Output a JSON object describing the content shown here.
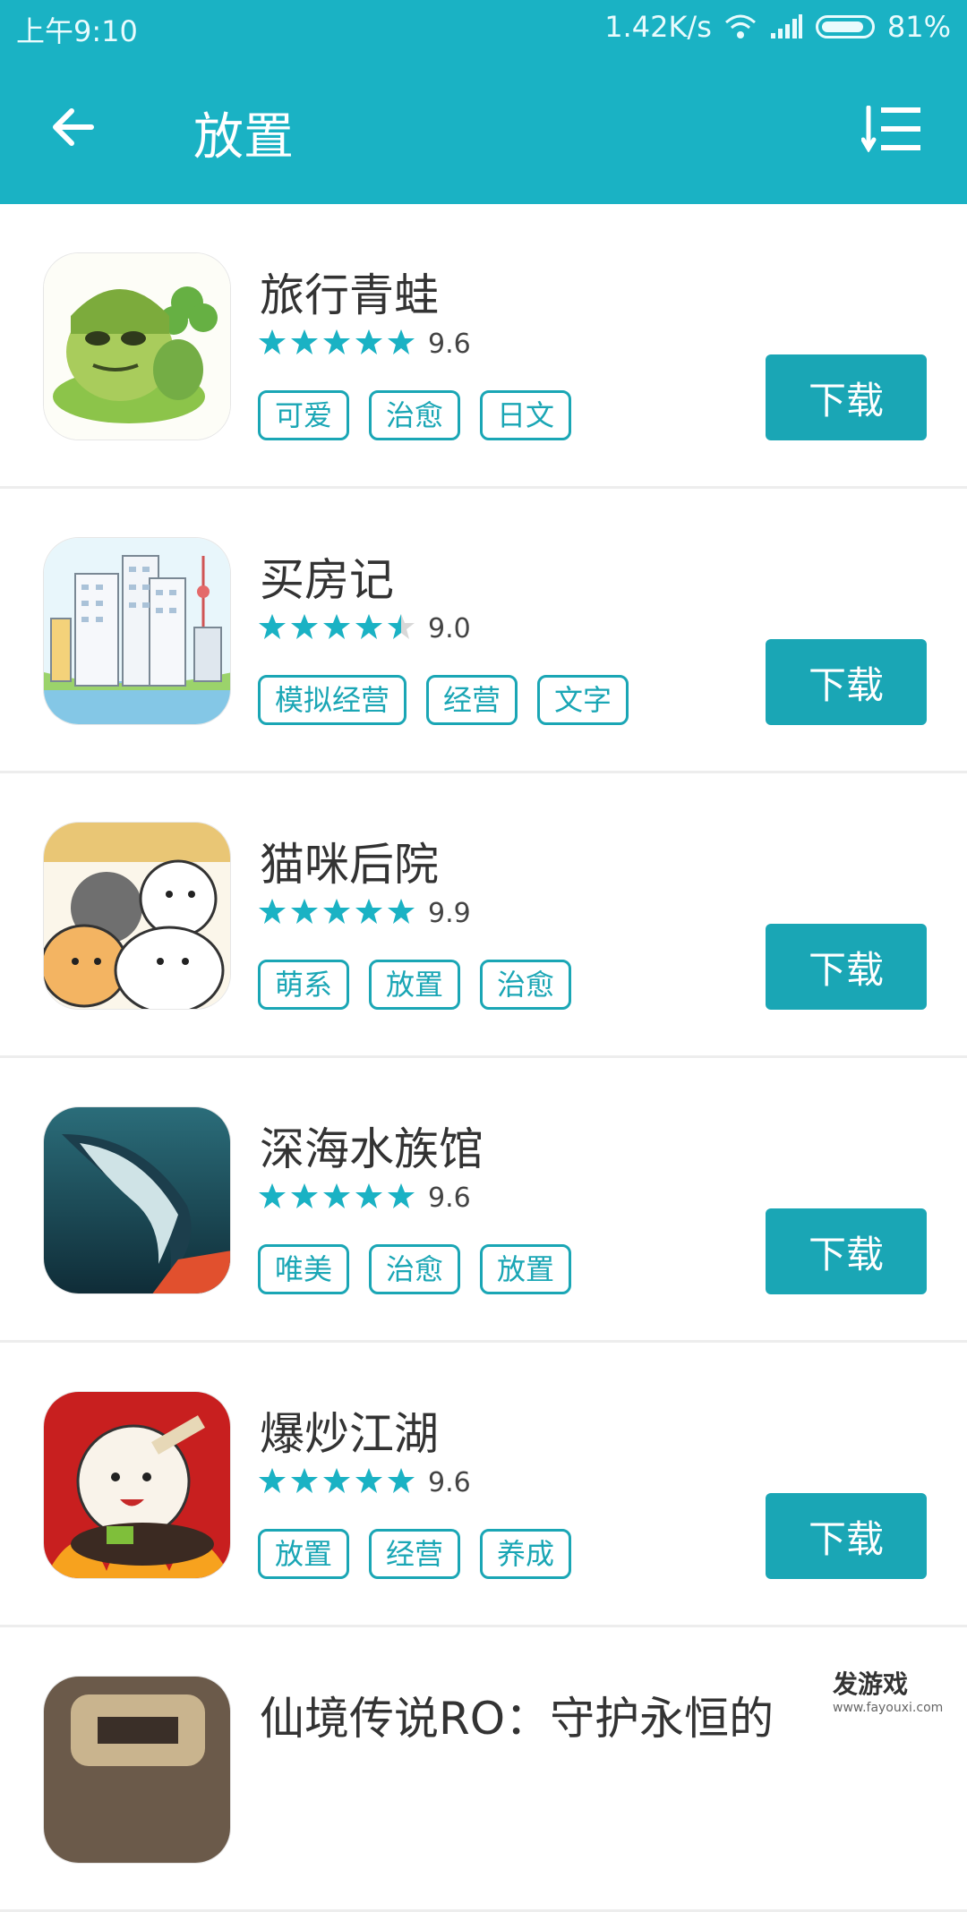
{
  "status_bar": {
    "time": "上午9:10",
    "speed": "1.42K/s",
    "battery": "81%"
  },
  "header": {
    "title": "放置"
  },
  "apps": [
    {
      "name": "旅行青蛙",
      "score": "9.6",
      "stars": 5,
      "tags": [
        "可爱",
        "治愈",
        "日文"
      ],
      "button": "下载"
    },
    {
      "name": "买房记",
      "score": "9.0",
      "stars": 4.5,
      "tags": [
        "模拟经营",
        "经营",
        "文字"
      ],
      "button": "下载"
    },
    {
      "name": "猫咪后院",
      "score": "9.9",
      "stars": 5,
      "tags": [
        "萌系",
        "放置",
        "治愈"
      ],
      "button": "下载"
    },
    {
      "name": "深海水族馆",
      "score": "9.6",
      "stars": 5,
      "tags": [
        "唯美",
        "治愈",
        "放置"
      ],
      "button": "下载"
    },
    {
      "name": "爆炒江湖",
      "score": "9.6",
      "stars": 5,
      "tags": [
        "放置",
        "经营",
        "养成"
      ],
      "button": "下载"
    },
    {
      "name": "仙境传说RO：守护永恒的",
      "score": "",
      "stars": 0,
      "tags": [],
      "button": ""
    }
  ],
  "watermark": {
    "brand": "发游戏",
    "url": "www.fayouxi.com"
  },
  "colors": {
    "primary": "#1ab2c4",
    "button": "#1aa6b5",
    "tag": "#1aa6b5",
    "star": "#1ab2c4"
  }
}
